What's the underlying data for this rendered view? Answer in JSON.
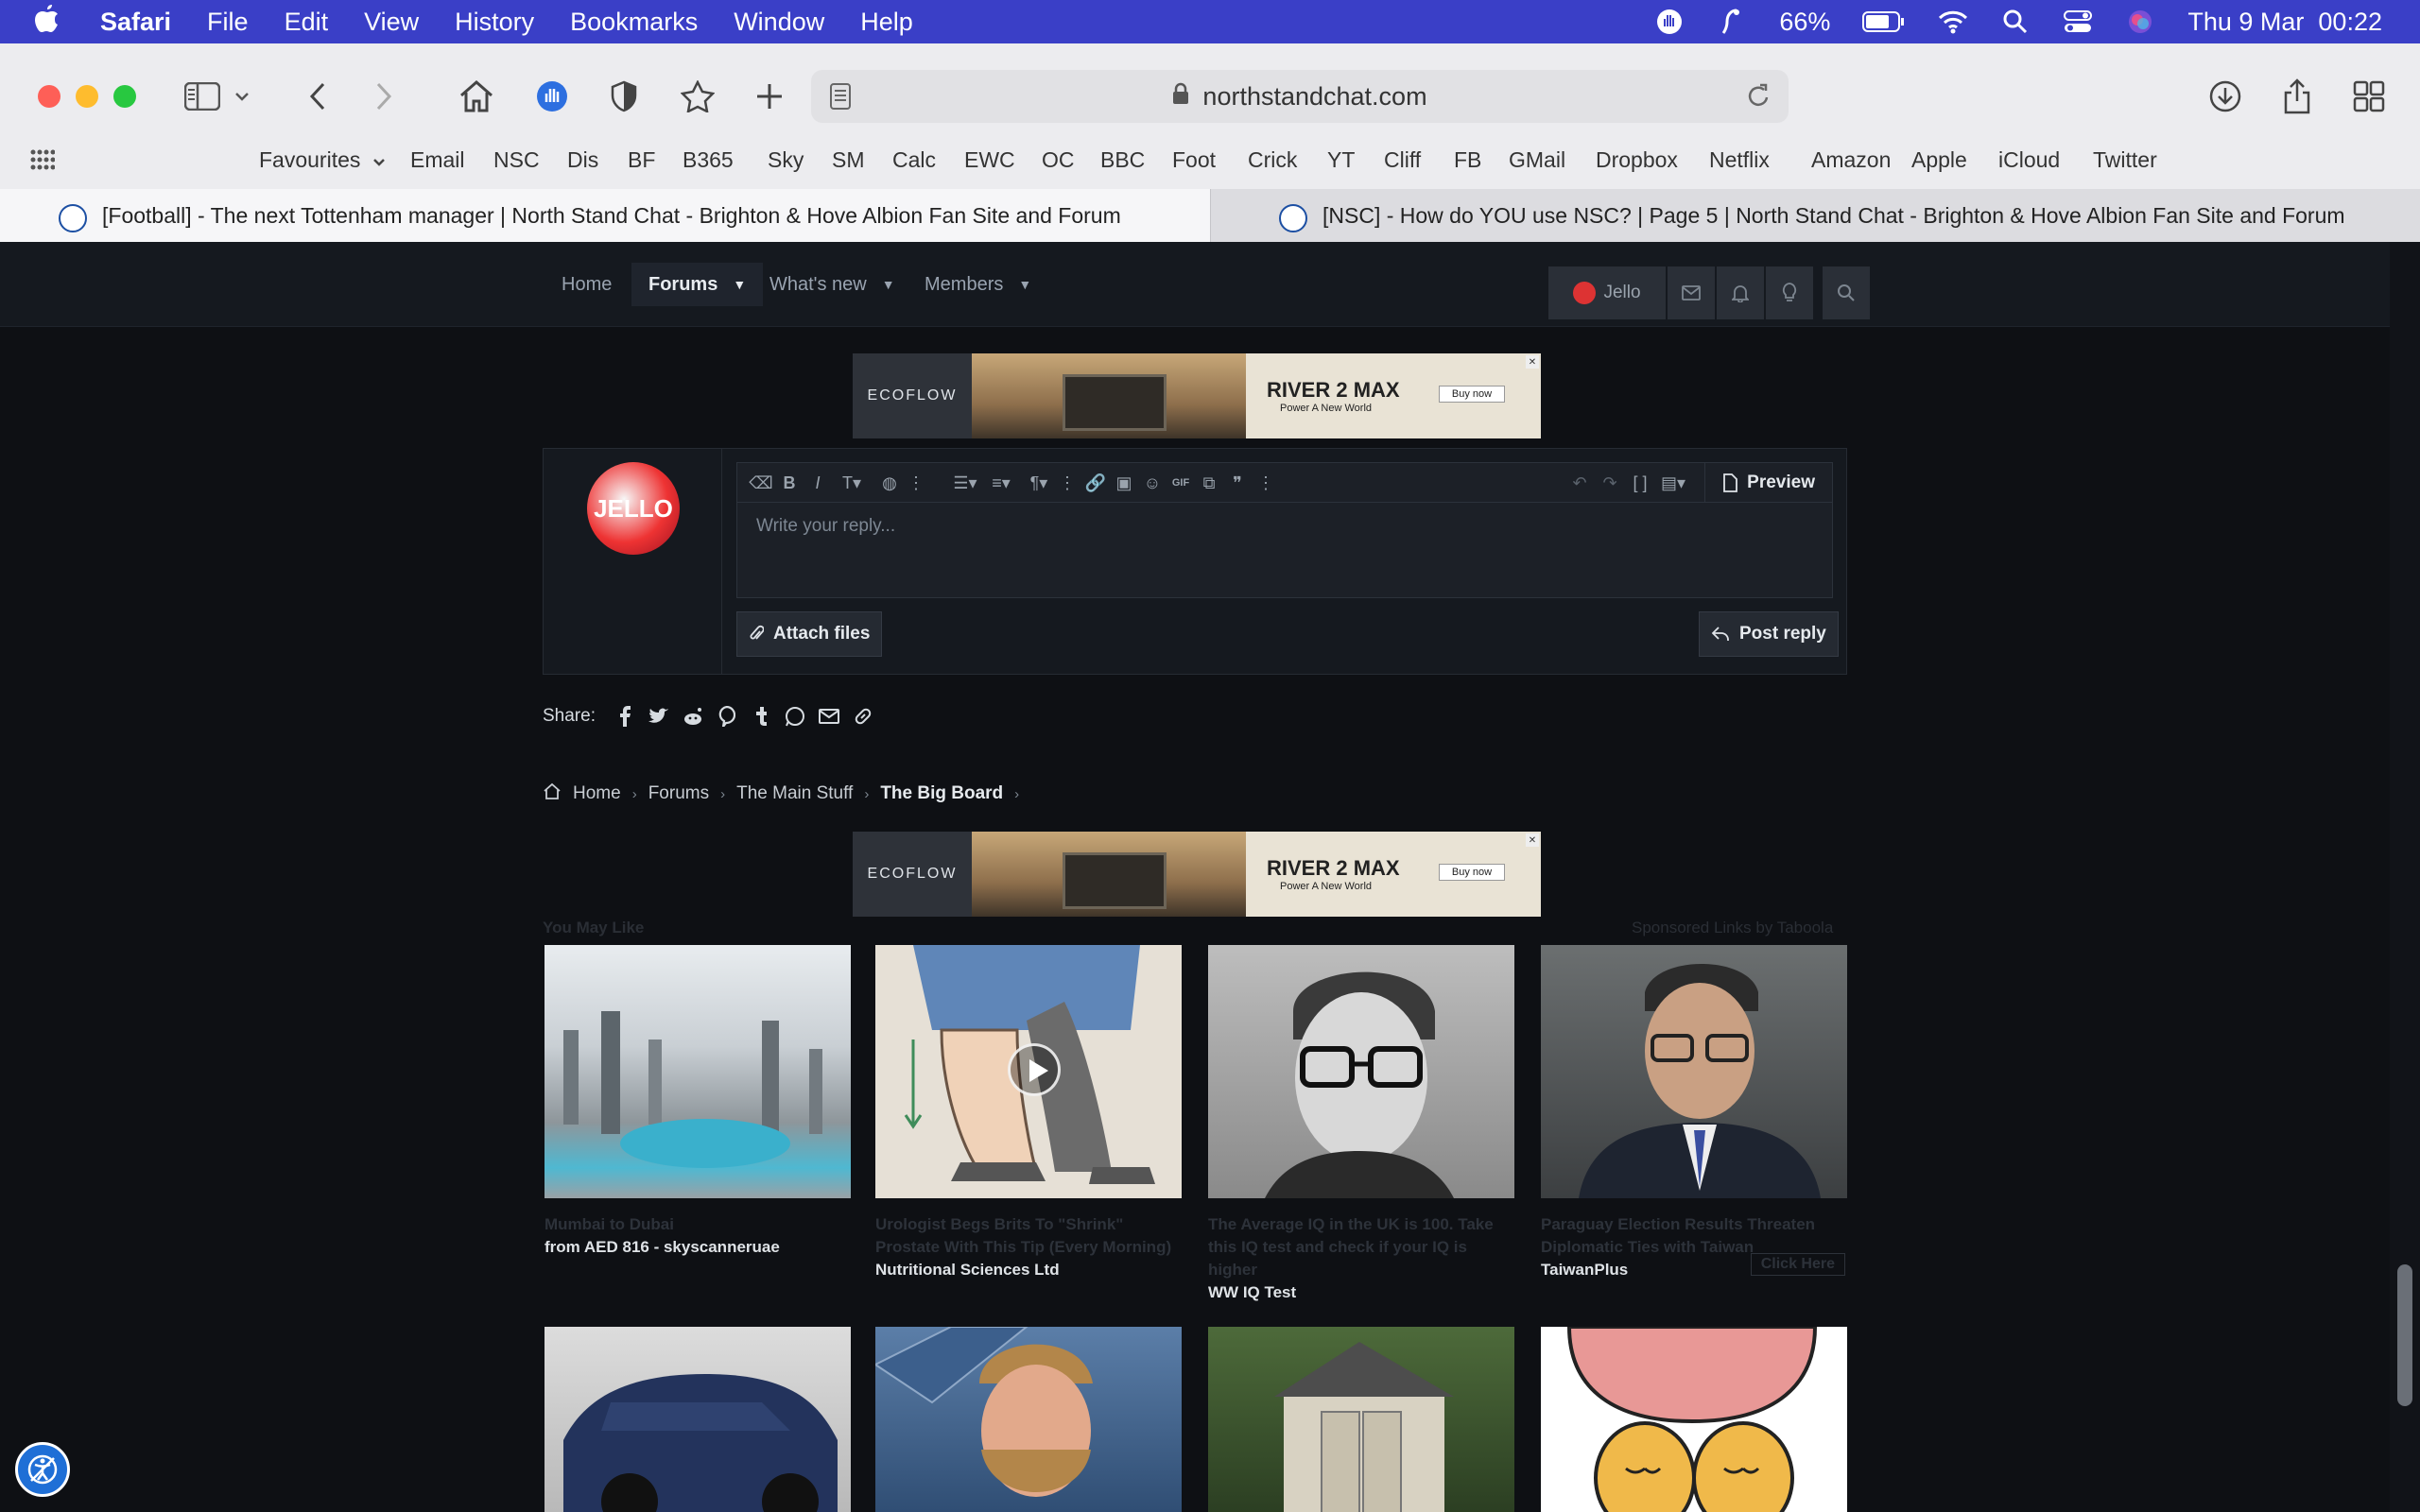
{
  "menubar": {
    "app": "Safari",
    "items": [
      "File",
      "Edit",
      "View",
      "History",
      "Bookmarks",
      "Window",
      "Help"
    ],
    "battery": "66%",
    "clock": "Thu 9 Mar  00:22"
  },
  "browser": {
    "url": "northstandchat.com",
    "favourites_label": "Favourites",
    "bookmarks": [
      "Email",
      "NSC",
      "Dis",
      "BF",
      "B365",
      "Sky",
      "SM",
      "Calc",
      "EWC",
      "OC",
      "BBC",
      "Foot",
      "Crick",
      "YT",
      "Cliff",
      "FB",
      "GMail",
      "Dropbox",
      "Netflix",
      "Amazon",
      "Apple",
      "iCloud",
      "Twitter"
    ],
    "tabs": [
      {
        "title": "[Football] - The next Tottenham manager | North Stand Chat - Brighton & Hove Albion Fan Site and Forum"
      },
      {
        "title": "[NSC] - How do YOU use NSC? | Page 5 | North Stand Chat - Brighton & Hove Albion Fan Site and Forum"
      }
    ]
  },
  "site_nav": {
    "home": "Home",
    "forums": "Forums",
    "whats_new": "What's new",
    "members": "Members",
    "user": "Jello"
  },
  "ad": {
    "brand": "ECOFLOW",
    "headline": "RIVER 2 MAX",
    "tagline": "Power A New World",
    "cta": "Buy now"
  },
  "reply": {
    "avatar_text": "JELLO",
    "placeholder": "Write your reply...",
    "preview": "Preview",
    "attach": "Attach files",
    "post": "Post reply"
  },
  "share": {
    "label": "Share:"
  },
  "breadcrumb": [
    "Home",
    "Forums",
    "The Main Stuff",
    "The Big Board"
  ],
  "recommendations": {
    "heading": "You May Like",
    "sponsored": "Sponsored Links by Taboola",
    "click_here": "Click Here",
    "cards": [
      {
        "title": "Mumbai to Dubai",
        "source": "from AED 816 - skyscanneruae"
      },
      {
        "title": "Urologist Begs Brits To \"Shrink\" Prostate With This Tip (Every Morning)",
        "source": "Nutritional Sciences Ltd"
      },
      {
        "title": "The Average IQ in the UK is 100. Take this IQ test and check if your IQ is higher",
        "source": "WW IQ Test"
      },
      {
        "title": "Paraguay Election Results Threaten Diplomatic Ties with Taiwan",
        "source": "TaiwanPlus"
      }
    ]
  }
}
